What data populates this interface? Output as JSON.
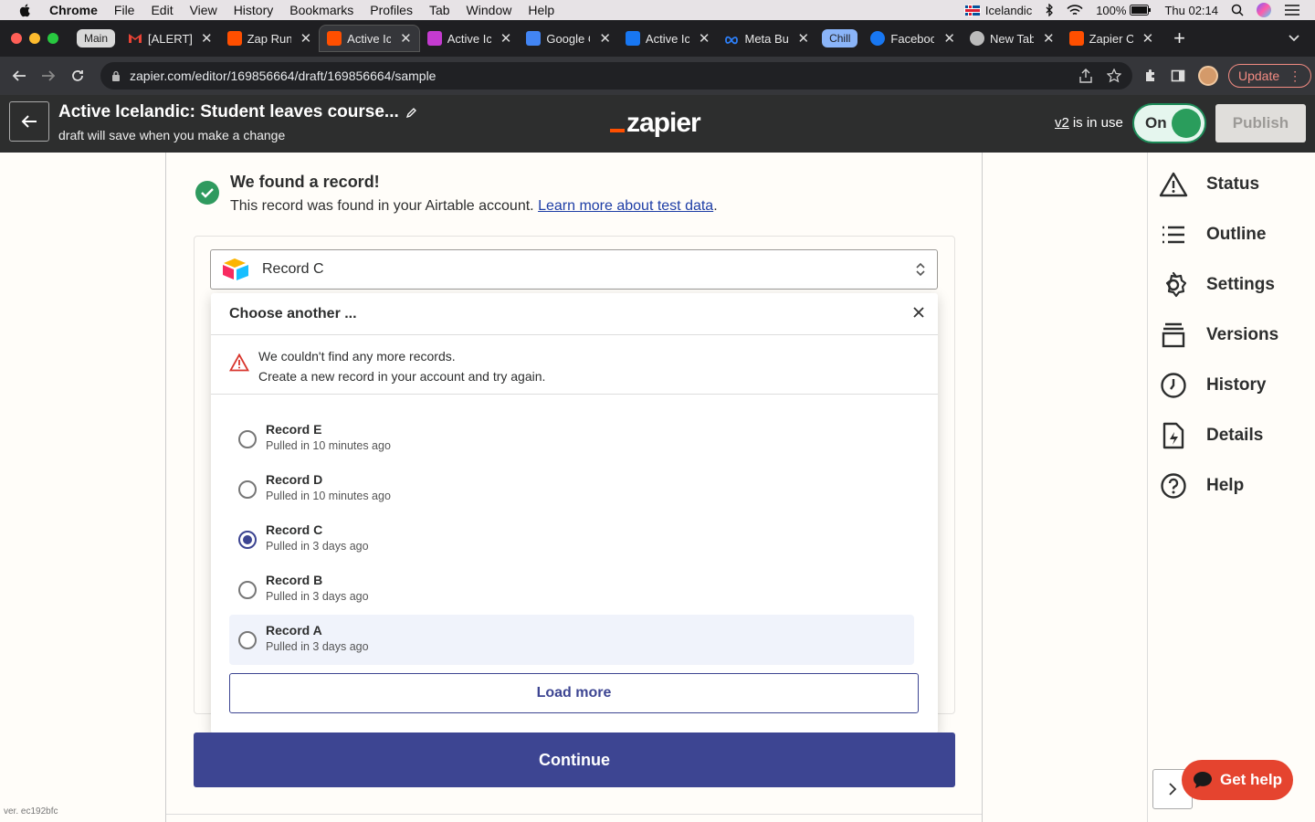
{
  "menubar": {
    "app": "Chrome",
    "items": [
      "File",
      "Edit",
      "View",
      "History",
      "Bookmarks",
      "Profiles",
      "Tab",
      "Window",
      "Help"
    ],
    "input_source": "Icelandic",
    "battery": "100%",
    "clock": "Thu 02:14"
  },
  "tabs": {
    "group_main": "Main",
    "group_chill": "Chill",
    "items": [
      {
        "label": "[ALERT]",
        "favicon_color": "#ea4335"
      },
      {
        "label": "Zap Run",
        "favicon_color": "#ff4f00"
      },
      {
        "label": "Active Ic",
        "favicon_color": "#ff4f00"
      },
      {
        "label": "Active Ic",
        "favicon_color": "#c43bd0"
      },
      {
        "label": "Google C",
        "favicon_color": "#4285f4"
      },
      {
        "label": "Active Ic",
        "favicon_color": "#1877f2"
      },
      {
        "label": "Meta Bu",
        "favicon_color": "#0668e1"
      },
      {
        "label": "Faceboo",
        "favicon_color": "#1877f2"
      },
      {
        "label": "New Tab",
        "favicon_color": "#bbbbbb"
      },
      {
        "label": "Zapier C",
        "favicon_color": "#ff4f00"
      }
    ]
  },
  "address": {
    "url": "zapier.com/editor/169856664/draft/169856664/sample",
    "update_label": "Update"
  },
  "header": {
    "zap_title": "Active Icelandic: Student leaves course...",
    "subtitle": "draft will save when you make a change",
    "logo": "zapier",
    "version_link": "v2",
    "version_text": "is in use",
    "toggle_label": "On",
    "publish_label": "Publish"
  },
  "result": {
    "title": "We found a record!",
    "text": "This record was found in your Airtable account.",
    "link": "Learn more about test data",
    "link_suffix": "."
  },
  "record_select": {
    "selected": "Record C"
  },
  "dropdown": {
    "title": "Choose another ...",
    "warning_line1": "We couldn't find any more records.",
    "warning_line2": "Create a new record in your account and try again.",
    "records": [
      {
        "name": "Record E",
        "pulled": "Pulled in 10 minutes ago",
        "checked": false
      },
      {
        "name": "Record D",
        "pulled": "Pulled in 10 minutes ago",
        "checked": false
      },
      {
        "name": "Record C",
        "pulled": "Pulled in 3 days ago",
        "checked": true
      },
      {
        "name": "Record B",
        "pulled": "Pulled in 3 days ago",
        "checked": false
      },
      {
        "name": "Record A",
        "pulled": "Pulled in 3 days ago",
        "checked": false
      }
    ],
    "load_more": "Load more"
  },
  "continue_label": "Continue",
  "version_tag": "ver. ec192bfc",
  "sidebar": {
    "items": [
      {
        "label": "Status",
        "icon": "warning-icon"
      },
      {
        "label": "Outline",
        "icon": "list-icon"
      },
      {
        "label": "Settings",
        "icon": "gear-icon"
      },
      {
        "label": "Versions",
        "icon": "versions-icon"
      },
      {
        "label": "History",
        "icon": "clock-icon"
      },
      {
        "label": "Details",
        "icon": "file-bolt-icon"
      },
      {
        "label": "Help",
        "icon": "question-icon"
      }
    ]
  },
  "get_help_label": "Get help",
  "colors": {
    "accent": "#3d4592",
    "zapier_orange": "#ff4f00",
    "success": "#2f9a5f",
    "get_help": "#e5442f"
  }
}
